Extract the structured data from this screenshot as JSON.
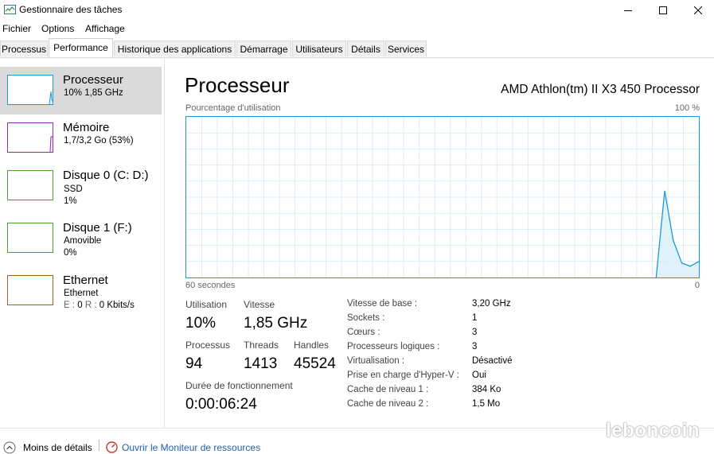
{
  "window": {
    "title": "Gestionnaire des tâches"
  },
  "menu": [
    "Fichier",
    "Options",
    "Affichage"
  ],
  "tabs": [
    "Processus",
    "Performance",
    "Historique des applications",
    "Démarrage",
    "Utilisateurs",
    "Détails",
    "Services"
  ],
  "active_tab": "Performance",
  "sidebar": [
    {
      "title": "Processeur",
      "line1": "10% 1,85 GHz",
      "line2": "",
      "color": "#1a9bd6",
      "selected": true
    },
    {
      "title": "Mémoire",
      "line1": "1,7/3,2 Go (53%)",
      "line2": "",
      "color": "#8b2fa8",
      "selected": false
    },
    {
      "title": "Disque 0 (C: D:)",
      "line1": "SSD",
      "line2": "1%",
      "color": "#4ca32e",
      "selected": false
    },
    {
      "title": "Disque 1 (F:)",
      "line1": "Amovible",
      "line2": "0%",
      "color": "#4ca32e",
      "selected": false
    },
    {
      "title": "Ethernet",
      "line1": "Ethernet",
      "line2_prefix_e": "E : ",
      "line2_e": "0",
      "line2_prefix_r": " R : ",
      "line2_r": "0 Kbits/s",
      "color": "#a0601e",
      "selected": false
    }
  ],
  "main": {
    "heading": "Processeur",
    "cpu_name": "AMD Athlon(tm) II X3 450 Processor",
    "graph_label": "Pourcentage d'utilisation",
    "graph_max": "100 %",
    "graph_time": "60 secondes",
    "graph_min": "0",
    "graph_color": "#1a9bd6",
    "graph_values": [
      0,
      0,
      0,
      0,
      0,
      0,
      0,
      0,
      0,
      0,
      0,
      0,
      0,
      0,
      0,
      0,
      0,
      0,
      0,
      0,
      0,
      0,
      0,
      0,
      0,
      0,
      0,
      0,
      0,
      0,
      0,
      0,
      0,
      0,
      0,
      0,
      0,
      0,
      0,
      0,
      0,
      0,
      0,
      0,
      0,
      0,
      0,
      0,
      0,
      0,
      0,
      0,
      0,
      0,
      0,
      0,
      54,
      23,
      9,
      7,
      10
    ]
  },
  "stats": {
    "utilisation_label": "Utilisation",
    "utilisation_value": "10%",
    "vitesse_label": "Vitesse",
    "vitesse_value": "1,85 GHz",
    "processus_label": "Processus",
    "processus_value": "94",
    "threads_label": "Threads",
    "threads_value": "1413",
    "handles_label": "Handles",
    "handles_value": "45524",
    "uptime_label": "Durée de fonctionnement",
    "uptime_value": "0:00:06:24"
  },
  "info": [
    {
      "label": "Vitesse de base :",
      "value": "3,20 GHz"
    },
    {
      "label": "Sockets :",
      "value": "1"
    },
    {
      "label": "Cœurs :",
      "value": "3"
    },
    {
      "label": "Processeurs logiques :",
      "value": "3"
    },
    {
      "label": "Virtualisation :",
      "value": "Désactivé"
    },
    {
      "label": "Prise en charge d'Hyper-V :",
      "value": "Oui"
    },
    {
      "label": "Cache de niveau 1 :",
      "value": "384 Ko"
    },
    {
      "label": "Cache de niveau 2 :",
      "value": "1,5 Mo"
    }
  ],
  "footer": {
    "less_details": "Moins de détails",
    "open_monitor": "Ouvrir le Moniteur de ressources",
    "link_color": "#1e5fb4"
  },
  "watermark": "leboncoin"
}
